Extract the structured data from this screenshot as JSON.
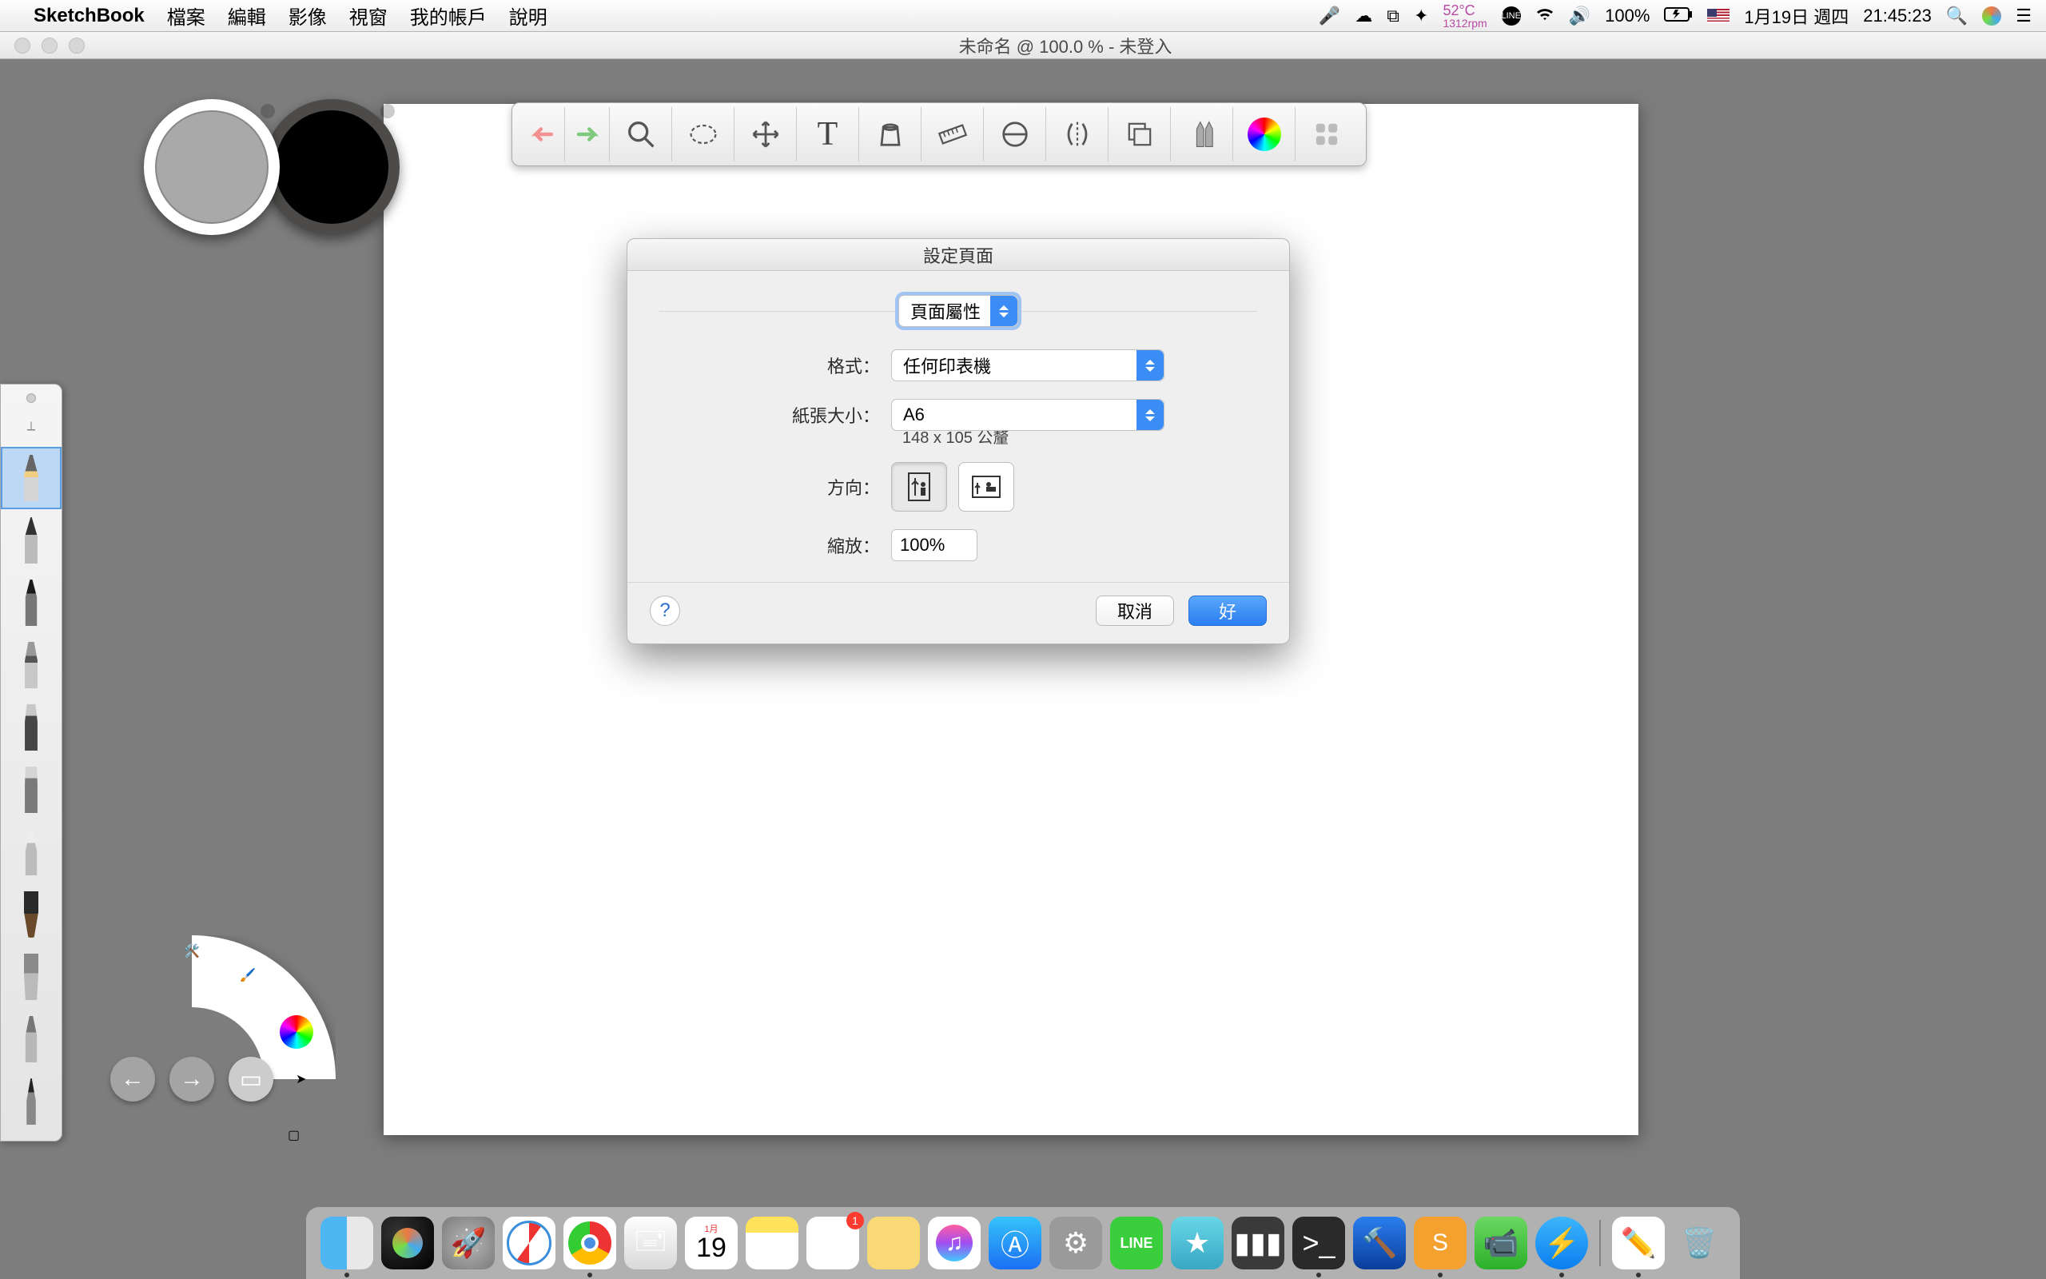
{
  "menubar": {
    "appname": "SketchBook",
    "items": [
      "檔案",
      "編輯",
      "影像",
      "視窗",
      "我的帳戶",
      "說明"
    ],
    "status": {
      "temp": "52°C",
      "fan": "1312rpm",
      "battery": "100%",
      "date": "1月19日 週四",
      "time": "21:45:23"
    }
  },
  "window": {
    "title": "未命名 @ 100.0 % - 未登入"
  },
  "toolbar_icons": [
    "undo",
    "redo",
    "zoom",
    "select",
    "transform",
    "text",
    "fill",
    "ruler",
    "guides",
    "symmetry",
    "layers",
    "brush",
    "color",
    "apps"
  ],
  "brushes": [
    "pencil",
    "tech-pen",
    "marker",
    "chisel",
    "flat-chisel",
    "flat-wide",
    "airbrush",
    "paintbrush",
    "fan-brush",
    "ink-pen",
    "fine-pen"
  ],
  "dialog": {
    "title": "設定頁面",
    "settings_label": "頁面屬性",
    "format_label": "格式：",
    "format_value": "任何印表機",
    "paper_label": "紙張大小：",
    "paper_value": "A6",
    "paper_hint": "148 x 105 公釐",
    "orient_label": "方向：",
    "scale_label": "縮放：",
    "scale_value": "100%",
    "cancel": "取消",
    "ok": "好"
  },
  "dock": {
    "cal_month": "1月",
    "cal_day": "19",
    "reminder_badge": "1",
    "line_label": "LINE"
  }
}
